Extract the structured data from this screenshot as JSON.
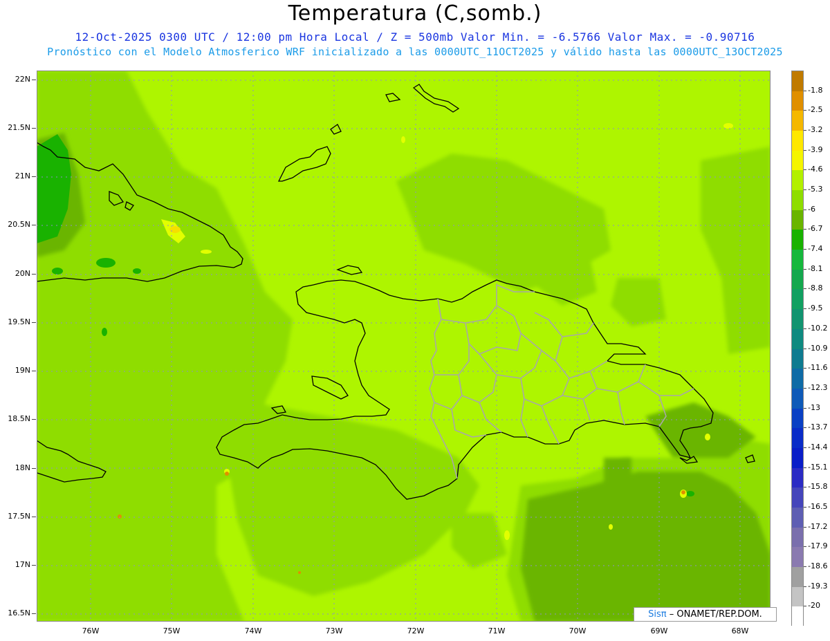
{
  "title": "Temperatura (C,somb.)",
  "subtitle1": "12-Oct-2025  0300 UTC / 12:00 pm Hora Local / Z = 500mb  Valor Min. = -6.5766  Valor Max. = -0.90716",
  "subtitle2": "Pronóstico con el Modelo Atmosferico WRF inicializado a las 0000UTC_11OCT2025 y válido hasta las  0000UTC_13OCT2025",
  "y_ticks": [
    "22N",
    "21.5N",
    "21N",
    "20.5N",
    "20N",
    "19.5N",
    "19N",
    "18.5N",
    "18N",
    "17.5N",
    "17N",
    "16.5N"
  ],
  "x_ticks": [
    "76W",
    "75W",
    "74W",
    "73W",
    "72W",
    "71W",
    "70W",
    "69W",
    "68W"
  ],
  "legend": {
    "labels": [
      "-1.8",
      "-2.5",
      "-3.2",
      "-3.9",
      "-4.6",
      "-5.3",
      "-6",
      "-6.7",
      "-7.4",
      "-8.1",
      "-8.8",
      "-9.5",
      "-10.2",
      "-10.9",
      "-11.6",
      "-12.3",
      "-13",
      "-13.7",
      "-14.4",
      "-15.1",
      "-15.8",
      "-16.5",
      "-17.2",
      "-17.9",
      "-18.6",
      "-19.3",
      "-20"
    ],
    "colors": [
      "#c07a00",
      "#e08f00",
      "#f5b800",
      "#ffe800",
      "#f5f500",
      "#b3f000",
      "#8fdd00",
      "#6ab500",
      "#19b200",
      "#16b83c",
      "#14a84e",
      "#12a061",
      "#129470",
      "#0f8a80",
      "#0f7b90",
      "#0f6ba6",
      "#0f5ab8",
      "#0a40c4",
      "#0a2cc8",
      "#0a1ec8",
      "#2b2bc4",
      "#4545bb",
      "#5e5eb3",
      "#7a6fad",
      "#8a7ab0",
      "#a0a0a0",
      "#c4c4c4",
      "#ffffff"
    ],
    "scale_colors": {
      "outline": "#000000",
      "border": "#a8a8a8",
      "grid": "#8f8fc8"
    }
  },
  "credit": {
    "logo": "Sisπ",
    "text": "– ONAMET/REP.DOM."
  },
  "map": {
    "lon_range": [
      -76.65,
      -67.65
    ],
    "lat_range": [
      16.4,
      22.05
    ]
  }
}
